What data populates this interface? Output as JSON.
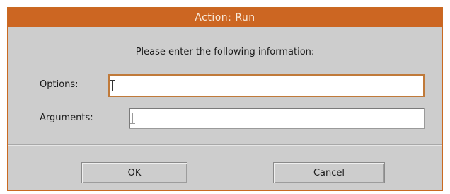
{
  "window": {
    "title": "Action: Run"
  },
  "form": {
    "prompt": "Please enter the following information:",
    "options": {
      "label": "Options:",
      "value": ""
    },
    "arguments": {
      "label": "Arguments:",
      "value": ""
    }
  },
  "buttons": {
    "ok": "OK",
    "cancel": "Cancel"
  },
  "colors": {
    "titlebar": "#cc6622",
    "dialog_background": "#cdcdcd"
  }
}
